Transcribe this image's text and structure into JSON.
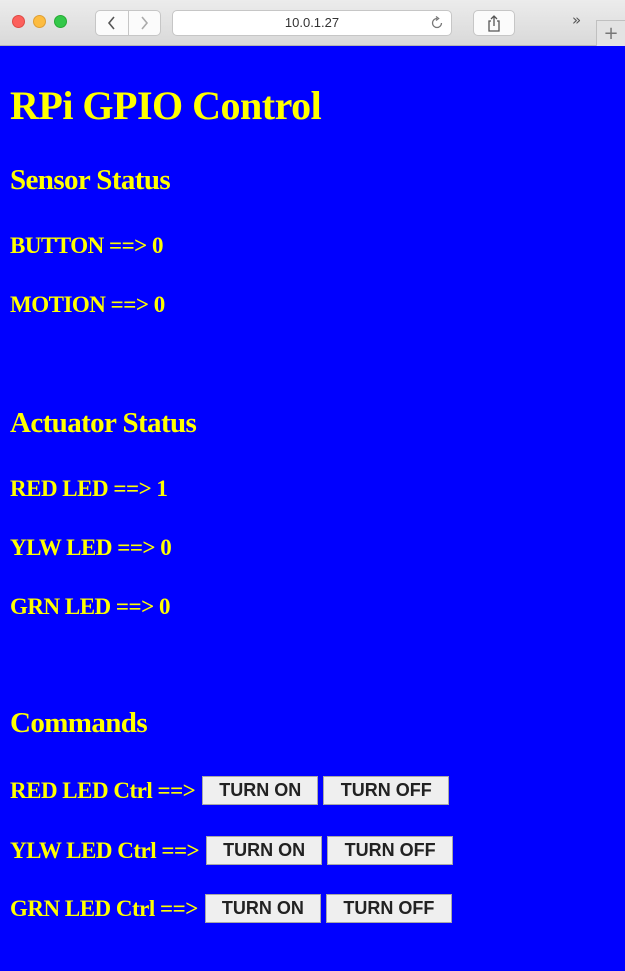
{
  "browser": {
    "url": "10.0.1.27",
    "more_glyph": "»",
    "new_tab_glyph": "+"
  },
  "page": {
    "title": "RPi GPIO Control",
    "sensor_heading": "Sensor Status",
    "sensors": [
      {
        "text": "BUTTON ==> 0"
      },
      {
        "text": "MOTION ==> 0"
      }
    ],
    "actuator_heading": "Actuator Status",
    "actuators": [
      {
        "text": "RED LED ==> 1"
      },
      {
        "text": "YLW LED ==> 0"
      },
      {
        "text": "GRN LED ==> 0"
      }
    ],
    "commands_heading": "Commands",
    "commands": [
      {
        "label": "RED LED Ctrl ==>",
        "on_label": "TURN ON",
        "off_label": "TURN OFF"
      },
      {
        "label": "YLW LED Ctrl ==>",
        "on_label": "TURN ON",
        "off_label": "TURN OFF"
      },
      {
        "label": "GRN LED Ctrl ==>",
        "on_label": "TURN ON",
        "off_label": "TURN OFF"
      }
    ]
  },
  "colors": {
    "background": "#0000ff",
    "text": "#ffff00",
    "button_bg": "#efefef"
  }
}
